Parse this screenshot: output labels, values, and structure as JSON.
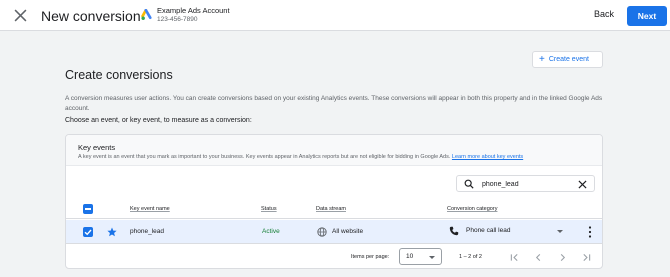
{
  "header": {
    "title": "New conversion",
    "account_name": "Example Ads Account",
    "account_id": "123-456-7890",
    "back_label": "Back",
    "next_label": "Next"
  },
  "create_event_label": "Create event",
  "section": {
    "title": "Create conversions",
    "description": "A conversion measures user actions. You can create conversions based on your existing Analytics events. These conversions will appear in both this property and in the linked Google Ads account.",
    "prompt": "Choose an event, or key event, to measure as a conversion:"
  },
  "card": {
    "title": "Key events",
    "description": "A key event is an event that you mark as important to your business. Key events appear in Analytics reports but are not eligible for bidding in Google Ads.",
    "link": "Learn more about key events"
  },
  "search": {
    "value": "phone_lead",
    "placeholder": ""
  },
  "table": {
    "headers": {
      "name": "Key event name",
      "status": "Status",
      "stream": "Data stream",
      "category": "Conversion category"
    },
    "rows": [
      {
        "name": "phone_lead",
        "status": "Active",
        "stream": "All website",
        "category": "Phone call lead"
      }
    ]
  },
  "pagination": {
    "items_label": "Items per page:",
    "page_size": "10",
    "range": "1 – 2 of 2"
  },
  "icons": {
    "close": "close-icon",
    "logo": "google-ads-logo",
    "search": "search-icon",
    "clear": "clear-icon",
    "star": "star-icon",
    "globe": "globe-icon",
    "phone": "phone-icon",
    "more": "more-vert-icon"
  },
  "colors": {
    "accent": "#1a73e8",
    "active": "#188038",
    "selected_row": "#e8f0fe"
  }
}
